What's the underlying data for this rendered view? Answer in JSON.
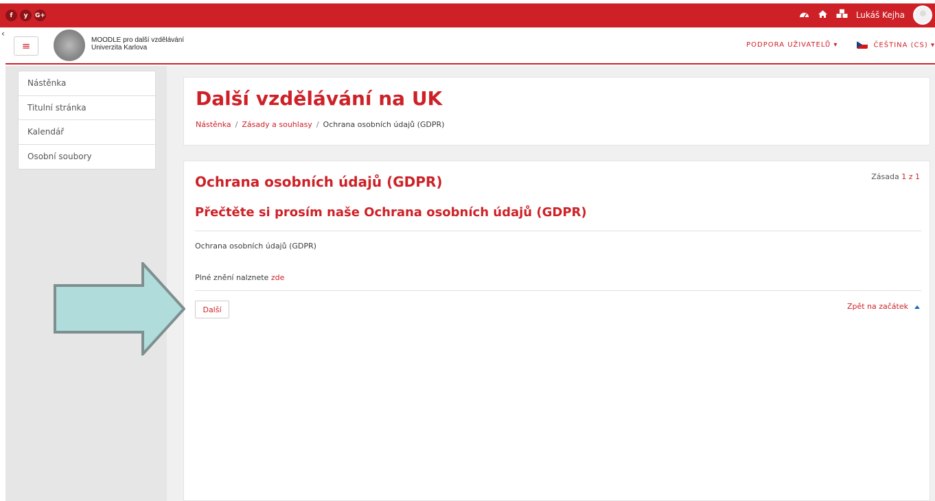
{
  "topbar": {
    "social": [
      "f",
      "y",
      "G+"
    ],
    "user_name": "Lukáš Kejha"
  },
  "navbar": {
    "back_char": "‹",
    "menu_char": "≡",
    "brand_line1": "MOODLE pro další vzdělávání",
    "brand_line2": "Univerzita Karlova",
    "support": "PODPORA UŽIVATELŮ ▾",
    "language": "ČEŠTINA (CS) ▾"
  },
  "sidebar": {
    "items": [
      {
        "label": "Nástěnka"
      },
      {
        "label": "Titulní stránka"
      },
      {
        "label": "Kalendář"
      },
      {
        "label": "Osobní soubory"
      }
    ]
  },
  "header": {
    "title": "Další vzdělávání na UK",
    "breadcrumb": [
      "Nástěnka",
      "Zásady a souhlasy",
      "Ochrana osobních údajů (GDPR)"
    ],
    "breadcrumb_sep": "/"
  },
  "policy": {
    "title": "Ochrana osobních údajů (GDPR)",
    "count_prefix": "Zásada",
    "count_current": "1",
    "count_of": "z",
    "count_total": "1",
    "subtitle": "Přečtěte si prosím naše Ochrana osobních údajů (GDPR)",
    "text1": "Ochrana osobních údajů (GDPR)",
    "text2_prefix": "Plné znění nalznete",
    "text2_link": "zde",
    "next_label": "Další",
    "back_to_top": "Zpět na začátek"
  },
  "colors": {
    "brand": "#cd2127",
    "arrow_fill": "#b1dcdc",
    "arrow_stroke": "#7e8f8f"
  }
}
